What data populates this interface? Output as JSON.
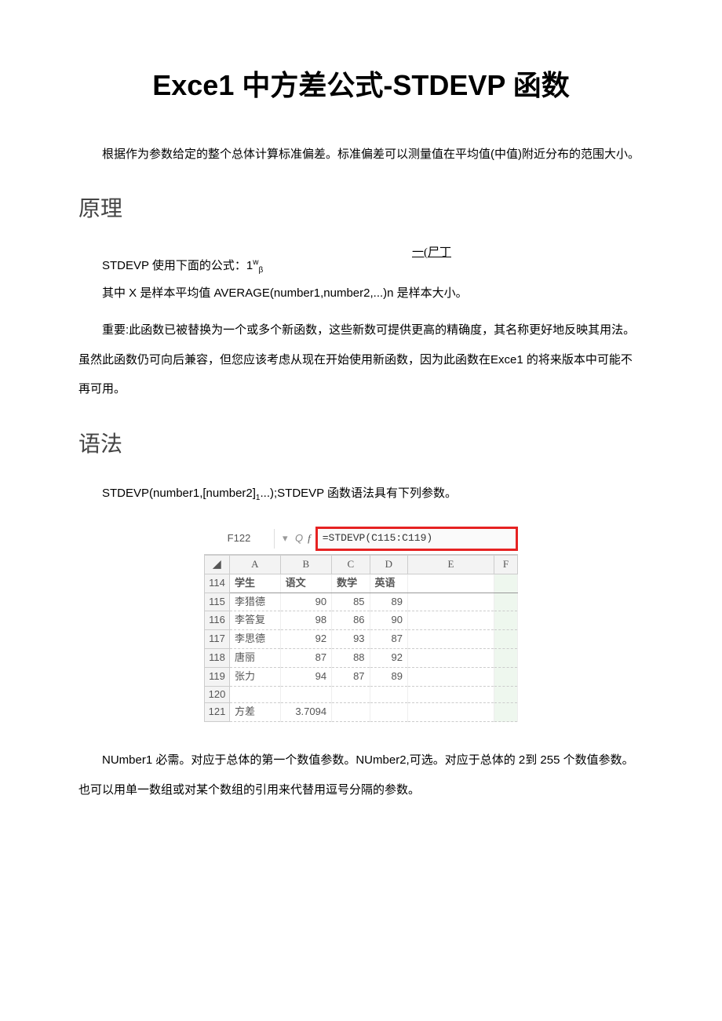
{
  "title": "Exce1 中方差公式-STDEVP 函数",
  "intro": "根据作为参数给定的整个总体计算标准偏差。标准偏差可以测量值在平均值(中值)附近分布的范围大小。",
  "sec1_head": "原理",
  "formula_top": "一(尸丁",
  "formula_line_pre": "STDEVP 使用下面的公式：1",
  "formula_line_sup": "w",
  "formula_line_sub": "β",
  "p_sample": "其中 X 是样本平均值 AVERAGE(number1,number2,...)n 是样本大小。",
  "p_important": "重要:此函数已被替换为一个或多个新函数，这些新数可提供更高的精确度，其名称更好地反映其用法。虽然此函数仍可向后兼容，但您应该考虑从现在开始使用新函数，因为此函数在Exce1 的将来版本中可能不再可用。",
  "sec2_head": "语法",
  "syntax_line_a": "STDEVP(number1,[number2]",
  "syntax_sub": "1",
  "syntax_line_b": "...);STDEVP 函数语法具有下列参数。",
  "namebox": "F122",
  "fx_icon_q": "Q",
  "fx_icon_f": "f",
  "formula_text": "=STDEVP(C115:C119)",
  "cols": [
    "A",
    "B",
    "C",
    "D",
    "E",
    "F"
  ],
  "rows": [
    {
      "n": "114",
      "a": "学生",
      "b": "语文",
      "c": "数学",
      "d": "英语",
      "e": "",
      "f": ""
    },
    {
      "n": "115",
      "a": "李猎德",
      "b": "90",
      "c": "85",
      "d": "89",
      "e": "",
      "f": ""
    },
    {
      "n": "116",
      "a": "李答复",
      "b": "98",
      "c": "86",
      "d": "90",
      "e": "",
      "f": ""
    },
    {
      "n": "117",
      "a": "李思德",
      "b": "92",
      "c": "93",
      "d": "87",
      "e": "",
      "f": ""
    },
    {
      "n": "118",
      "a": "唐丽",
      "b": "87",
      "c": "88",
      "d": "92",
      "e": "",
      "f": ""
    },
    {
      "n": "119",
      "a": "张力",
      "b": "94",
      "c": "87",
      "d": "89",
      "e": "",
      "f": ""
    },
    {
      "n": "120",
      "a": "",
      "b": "",
      "c": "",
      "d": "",
      "e": "",
      "f": ""
    },
    {
      "n": "121",
      "a": "方差",
      "b": "3.7094",
      "c": "",
      "d": "",
      "e": "",
      "f": ""
    }
  ],
  "p_number1": "NUmber1 必需。对应于总体的第一个数值参数。NUmber2,可选。对应于总体的 2到 255 个数值参数。也可以用单一数组或对某个数组的引用来代替用逗号分隔的参数。"
}
